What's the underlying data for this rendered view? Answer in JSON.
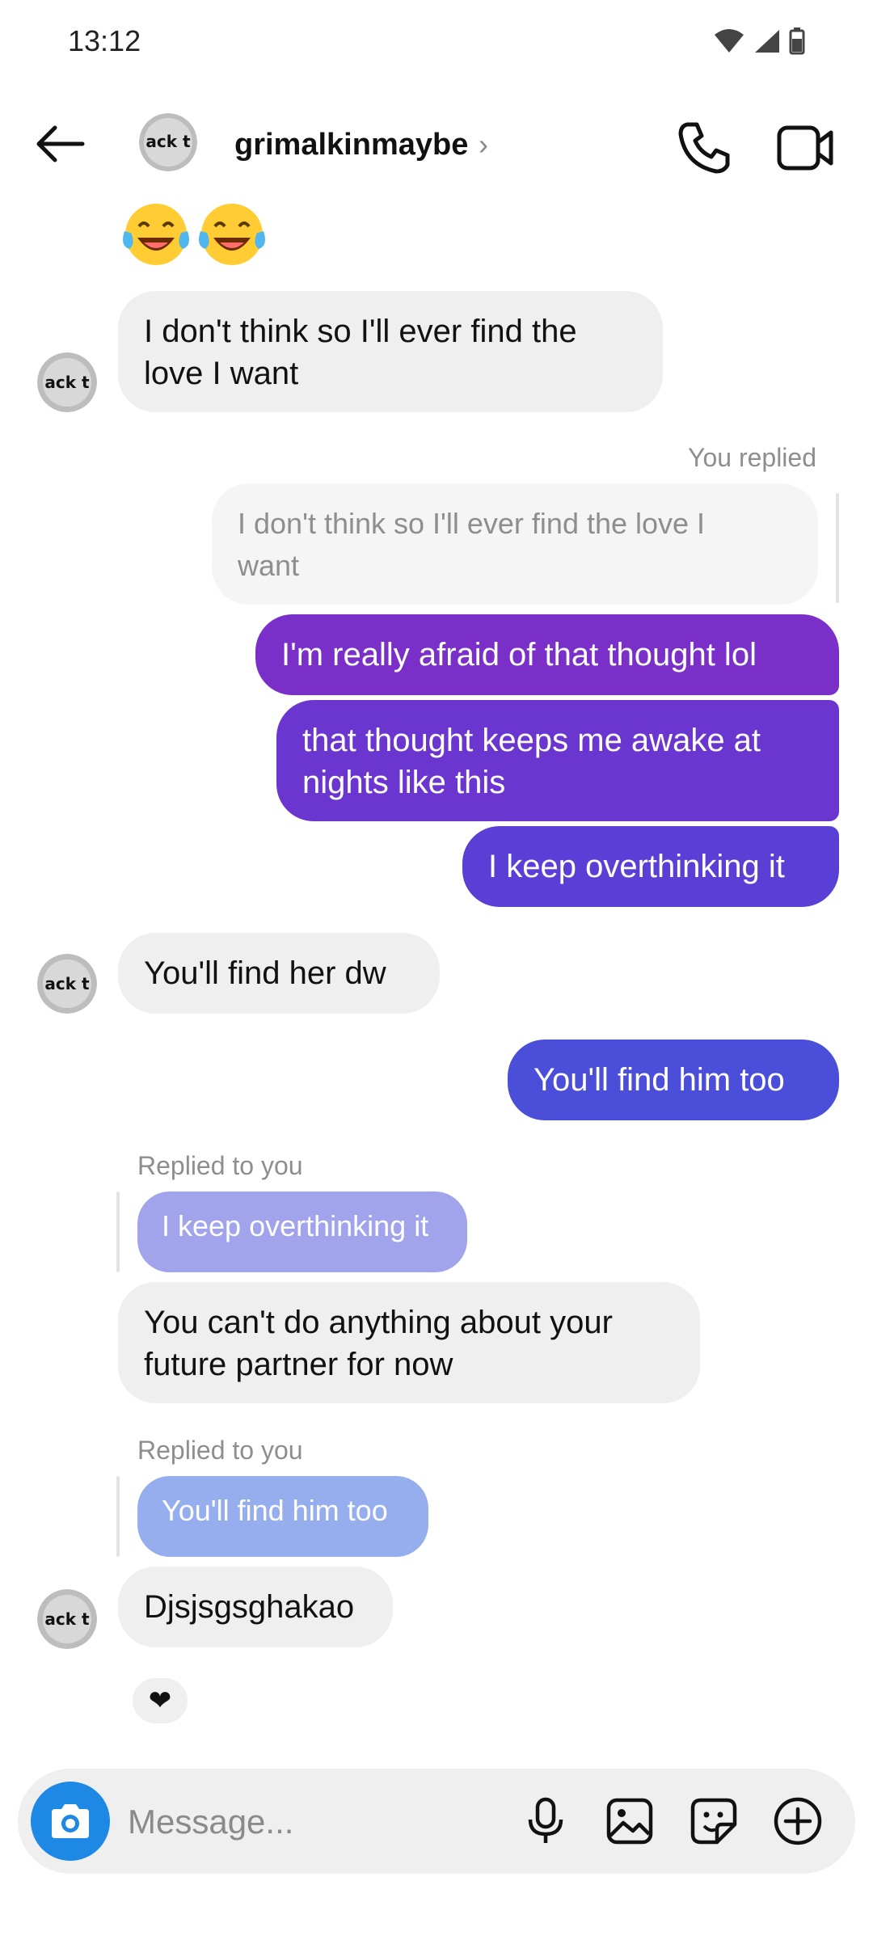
{
  "status_bar": {
    "time": "13:12"
  },
  "header": {
    "username": "grimalkinmaybe",
    "chevron": "›",
    "avatar_text": "ack t"
  },
  "emojis": [
    "😂",
    "😂"
  ],
  "messages": {
    "m1": "I don't think so I'll ever find the love I want",
    "m1_line1": "I don't think so I'll ever find the",
    "m1_line2": "love I want",
    "you_replied_label": "You replied",
    "quoted_m1_line1": "I don't think so I'll ever find the love I",
    "quoted_m1_line2": "want",
    "m2": "I'm really afraid of that thought lol",
    "m3_line1": "that thought keeps me awake at",
    "m3_line2": "nights like this",
    "m4": "I keep overthinking it",
    "m5": "You'll find her dw",
    "m6": "You'll find him too",
    "replied_to_you_label": "Replied to you",
    "quoted_m4": "I keep overthinking it",
    "m7_line1": "You can't do anything about your",
    "m7_line2": "future partner for now",
    "replied_to_you_label_2": "Replied to you",
    "quoted_m6": "You'll find him too",
    "m8": "Djsjsgsghakao"
  },
  "reaction": {
    "icon": "heart-icon",
    "glyph": "❤"
  },
  "composer": {
    "placeholder": "Message..."
  },
  "colors": {
    "out_purple_1": "#7b2fc9",
    "out_purple_2": "#6b36cf",
    "out_indigo": "#5a3fd6",
    "out_blue": "#4b4ed8",
    "quoted_lavender": "#a1a3eb",
    "quoted_blue": "#96aeee",
    "camera_blue": "#1e88e5"
  }
}
